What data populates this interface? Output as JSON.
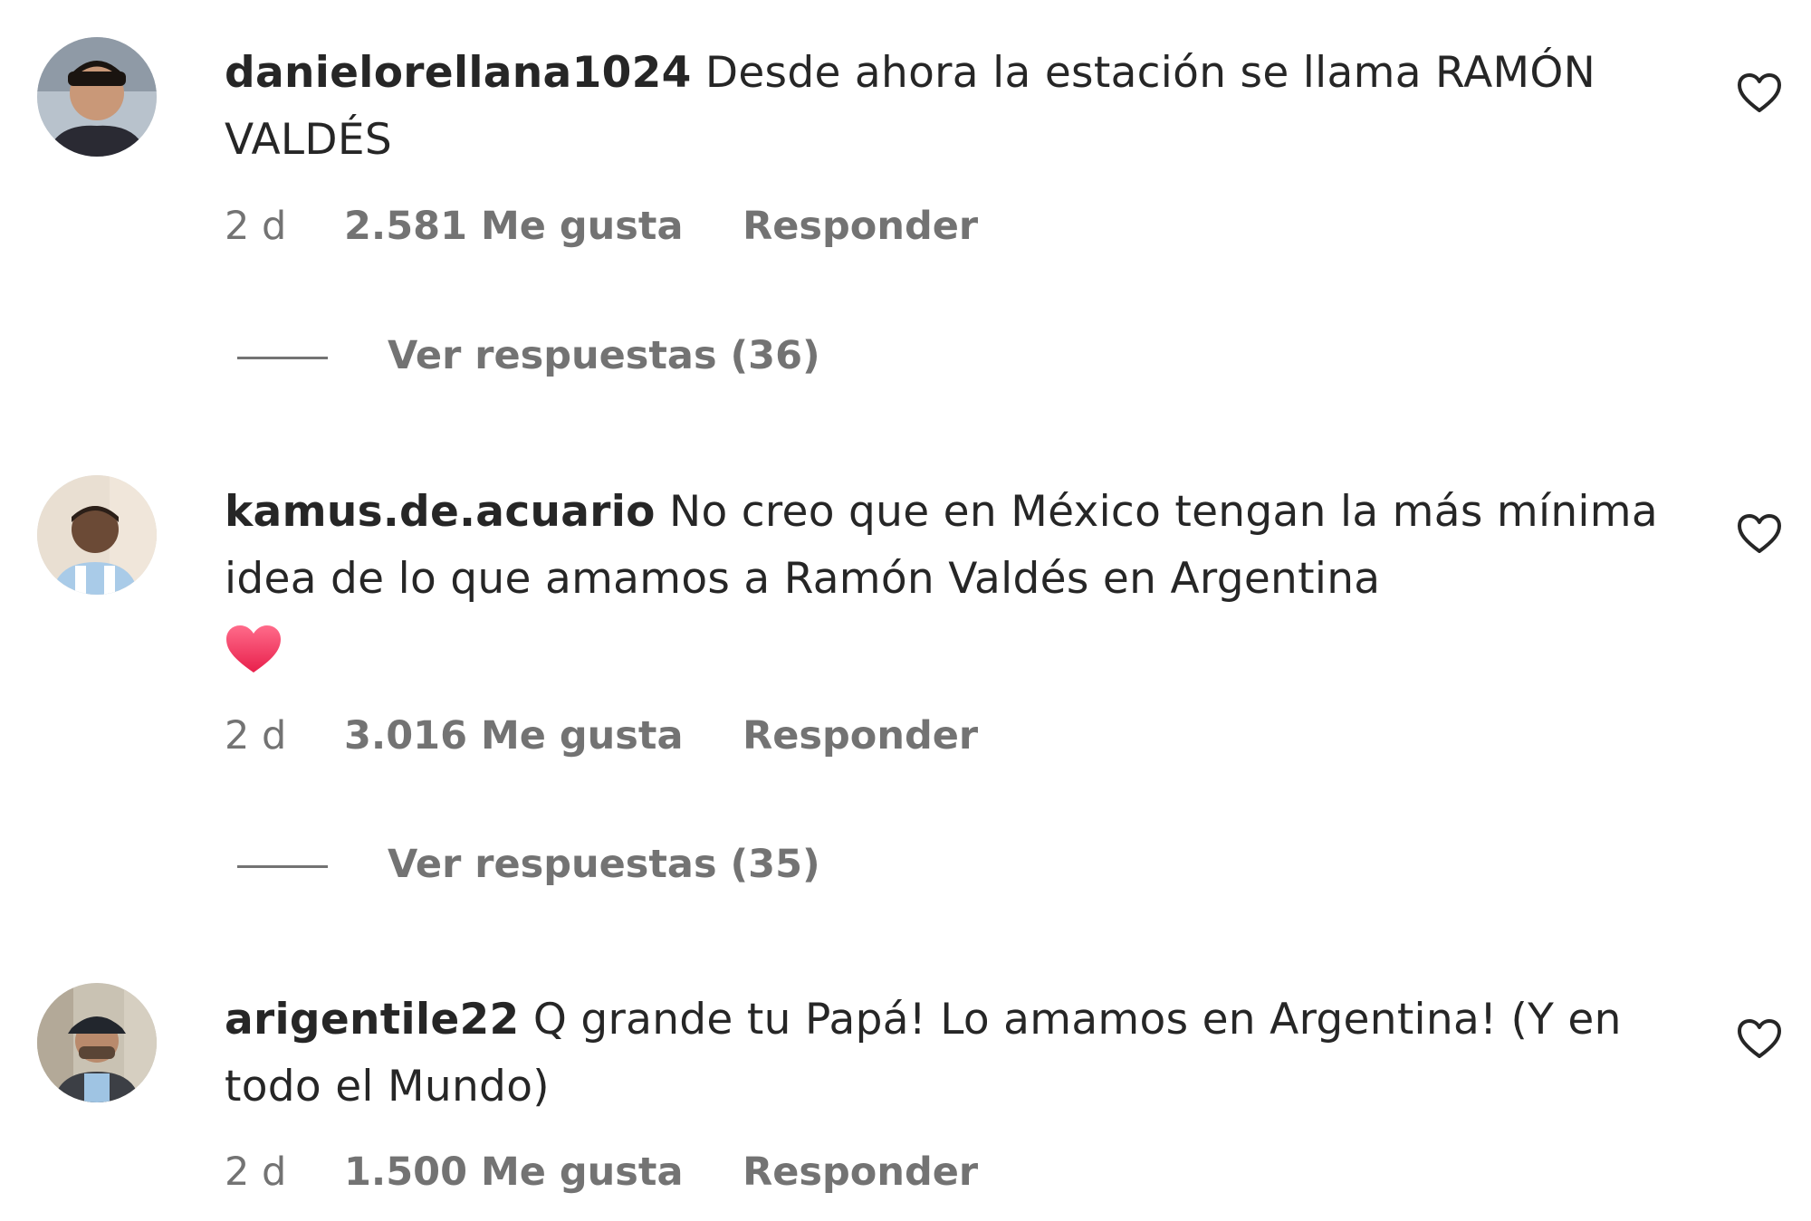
{
  "comments": [
    {
      "username": "danielorellana1024",
      "text": "Desde ahora la estación se llama RAMÓN VALDÉS",
      "time": "2 d",
      "likes": "2.581 Me gusta",
      "reply_label": "Responder",
      "view_replies": "Ver respuestas (36)",
      "avatar": "user-avatar",
      "like_icon": "heart-outline-icon"
    },
    {
      "username": "kamus.de.acuario",
      "text": "No creo que en México tengan la más mínima idea de lo que amamos a Ramón Valdés en Argentina",
      "emoji": "red-heart-emoji",
      "time": "2 d",
      "likes": "3.016 Me gusta",
      "reply_label": "Responder",
      "view_replies": "Ver respuestas (35)",
      "avatar": "user-avatar",
      "like_icon": "heart-outline-icon"
    },
    {
      "username": "arigentile22",
      "text": "Q grande tu Papá! Lo amamos en Argentina! (Y en todo el Mundo)",
      "time": "2 d",
      "likes": "1.500 Me gusta",
      "reply_label": "Responder",
      "avatar": "user-avatar",
      "like_icon": "heart-outline-icon"
    }
  ],
  "colors": {
    "primary_text": "#262626",
    "secondary_text": "#737373",
    "emoji_heart": "#f0325a"
  }
}
